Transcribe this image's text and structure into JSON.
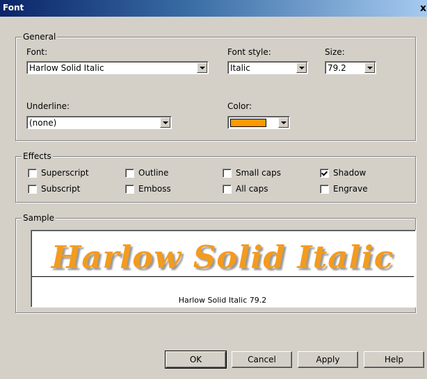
{
  "window": {
    "title": "Font",
    "close_label": "x"
  },
  "general": {
    "legend": "General",
    "font": {
      "label": "Font:",
      "value": "Harlow Solid Italic"
    },
    "font_style": {
      "label": "Font style:",
      "value": "Italic"
    },
    "size": {
      "label": "Size:",
      "value": "79.2"
    },
    "underline": {
      "label": "Underline:",
      "value": "(none)"
    },
    "color": {
      "label": "Color:",
      "value": "#ff9900"
    }
  },
  "effects": {
    "legend": "Effects",
    "items": [
      {
        "label": "Superscript",
        "checked": false
      },
      {
        "label": "Outline",
        "checked": false
      },
      {
        "label": "Small caps",
        "checked": false
      },
      {
        "label": "Shadow",
        "checked": true
      },
      {
        "label": "Subscript",
        "checked": false
      },
      {
        "label": "Emboss",
        "checked": false
      },
      {
        "label": "All caps",
        "checked": false
      },
      {
        "label": "Engrave",
        "checked": false
      }
    ]
  },
  "sample": {
    "legend": "Sample",
    "preview_text": "Harlow Solid Italic",
    "caption": "Harlow Solid Italic 79.2",
    "text_color": "#f39b1f"
  },
  "buttons": {
    "ok": "OK",
    "cancel": "Cancel",
    "apply": "Apply",
    "help": "Help"
  }
}
